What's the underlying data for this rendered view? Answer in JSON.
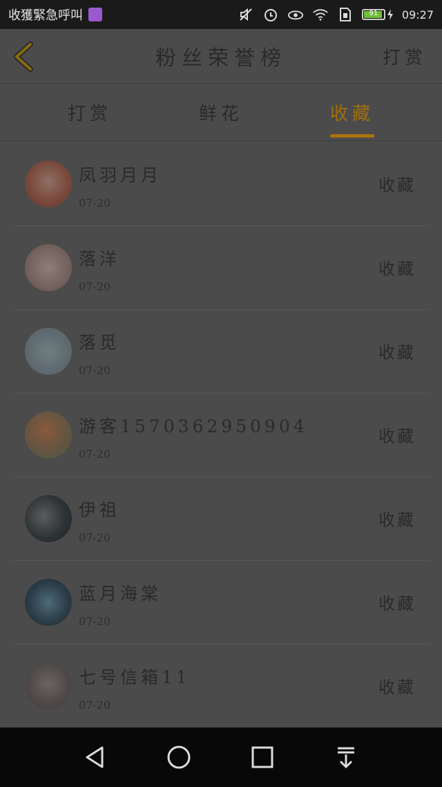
{
  "status_bar": {
    "notification_text": "收獲緊急呼叫",
    "icons": [
      "gallery-icon",
      "mute-icon",
      "alarm-icon",
      "eye-icon",
      "wifi-icon",
      "sim-icon",
      "battery-icon"
    ],
    "battery_level": "91",
    "time": "09:27"
  },
  "header": {
    "title": "粉丝荣誉榜",
    "right_button": "打赏",
    "back_icon": "chevron-left-icon"
  },
  "tabs": [
    {
      "label": "打赏",
      "active": false
    },
    {
      "label": "鲜花",
      "active": false
    },
    {
      "label": "收藏",
      "active": true
    }
  ],
  "items": [
    {
      "name": "凤羽月月",
      "date": "07-20",
      "action": "收藏"
    },
    {
      "name": "落洋",
      "date": "07-20",
      "action": "收藏"
    },
    {
      "name": "落觅",
      "date": "07-20",
      "action": "收藏"
    },
    {
      "name": "游客1570362950904",
      "date": "07-20",
      "action": "收藏"
    },
    {
      "name": "伊祖",
      "date": "07-20",
      "action": "收藏"
    },
    {
      "name": "蓝月海棠",
      "date": "07-20",
      "action": "收藏"
    },
    {
      "name": "七号信箱11",
      "date": "07-20",
      "action": "收藏"
    }
  ],
  "colors": {
    "accent": "#a8720d",
    "background": "#4b4b4b",
    "nav_bar": "#080808"
  },
  "nav_bar": [
    "back-triangle-icon",
    "home-circle-icon",
    "recents-square-icon",
    "pull-down-icon"
  ]
}
